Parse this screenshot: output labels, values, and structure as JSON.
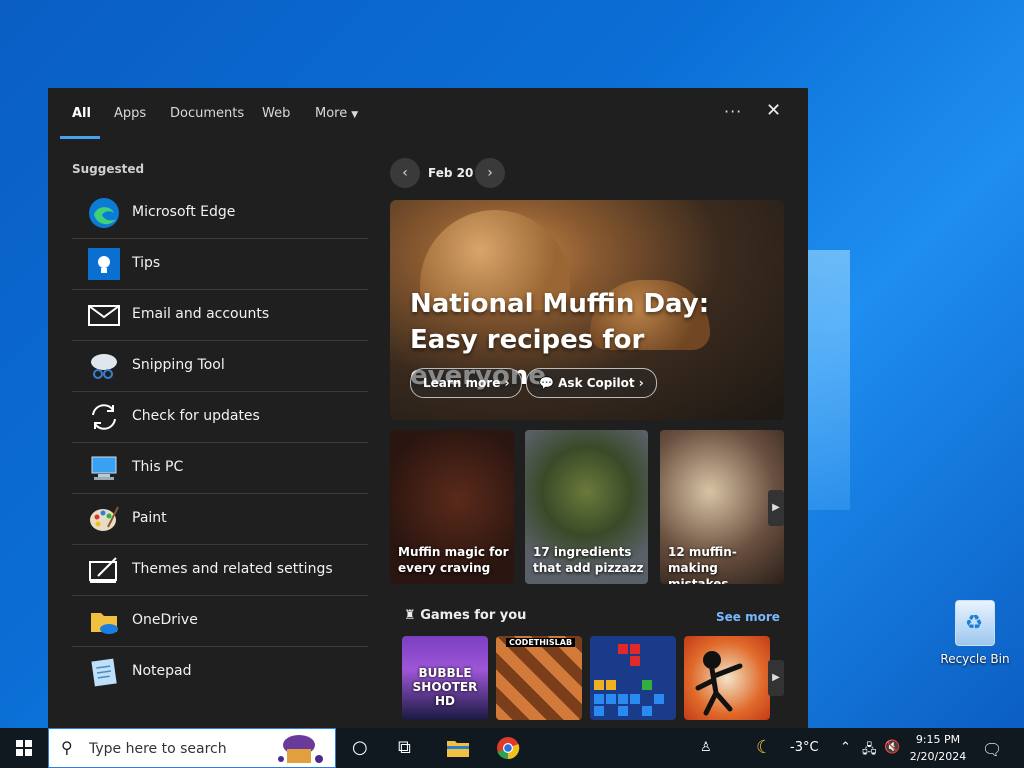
{
  "desktop": {
    "recycle_bin_label": "Recycle Bin"
  },
  "tabs": [
    {
      "label": "All",
      "active": true
    },
    {
      "label": "Apps"
    },
    {
      "label": "Documents"
    },
    {
      "label": "Web"
    },
    {
      "label": "More"
    }
  ],
  "header_icons": {
    "options": "options-dots-icon",
    "close": "close-icon"
  },
  "suggested": {
    "title": "Suggested",
    "items": [
      {
        "label": "Microsoft Edge",
        "icon": "edge-icon"
      },
      {
        "label": "Tips",
        "icon": "tips-lightbulb-icon"
      },
      {
        "label": "Email and accounts",
        "icon": "mail-icon"
      },
      {
        "label": "Snipping Tool",
        "icon": "scissors-icon"
      },
      {
        "label": "Check for updates",
        "icon": "refresh-icon"
      },
      {
        "label": "This PC",
        "icon": "computer-icon"
      },
      {
        "label": "Paint",
        "icon": "palette-icon"
      },
      {
        "label": "Themes and related settings",
        "icon": "themes-icon"
      },
      {
        "label": "OneDrive",
        "icon": "onedrive-folder-icon"
      },
      {
        "label": "Notepad",
        "icon": "notepad-icon"
      }
    ]
  },
  "feed": {
    "date": "Feb 20",
    "hero": {
      "title": "National Muffin Day: Easy recipes for everyone",
      "learn_more": "Learn more",
      "ask_copilot": "Ask Copilot"
    },
    "cards": [
      {
        "caption": "Muffin magic for every craving"
      },
      {
        "caption": "17 ingredients that add pizzazz"
      },
      {
        "caption": "12 muffin-making mistakes"
      }
    ],
    "games": {
      "title": "Games for you",
      "see_more": "See more",
      "tiles": [
        {
          "label": "BUBBLE SHOOTER HD"
        },
        {
          "label": "CODETHISLAB"
        },
        {
          "label": ""
        },
        {
          "label": ""
        }
      ]
    }
  },
  "taskbar": {
    "search_placeholder": "Type here to search",
    "weather": "-3°C",
    "time": "9:15 PM",
    "date": "2/20/2024"
  },
  "colors": {
    "accent": "#4aa0f0",
    "link": "#79b8ff",
    "panel_bg": "#1f1f1f",
    "taskbar_bg": "#101820"
  }
}
